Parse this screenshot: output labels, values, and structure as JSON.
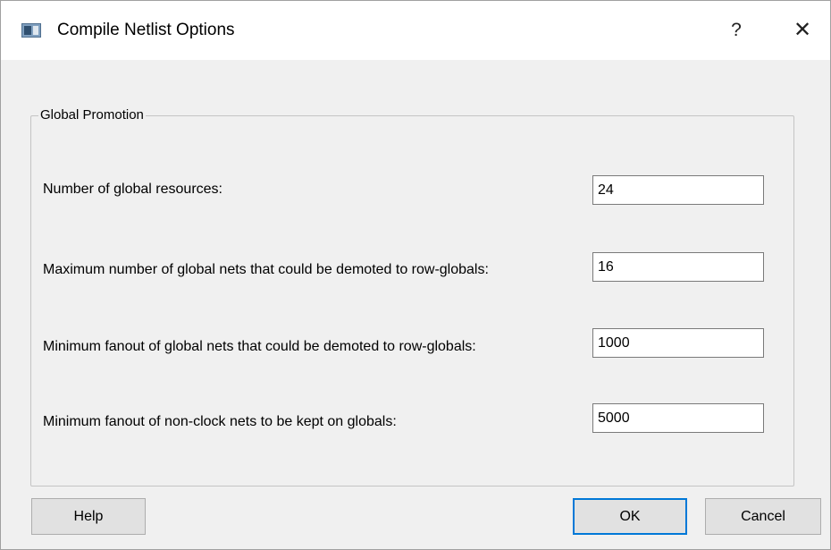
{
  "window": {
    "title": "Compile Netlist Options",
    "help_glyph": "?",
    "close_glyph": "✕"
  },
  "group": {
    "title": "Global Promotion",
    "fields": [
      {
        "label": "Number of global resources:",
        "value": "24"
      },
      {
        "label": "Maximum number of global nets that could be demoted to row-globals:",
        "value": "16"
      },
      {
        "label": "Minimum fanout of global nets that could be demoted to row-globals:",
        "value": "1000"
      },
      {
        "label": "Minimum fanout of non-clock nets to be kept on globals:",
        "value": "5000"
      }
    ]
  },
  "buttons": {
    "help": "Help",
    "ok": "OK",
    "cancel": "Cancel"
  }
}
